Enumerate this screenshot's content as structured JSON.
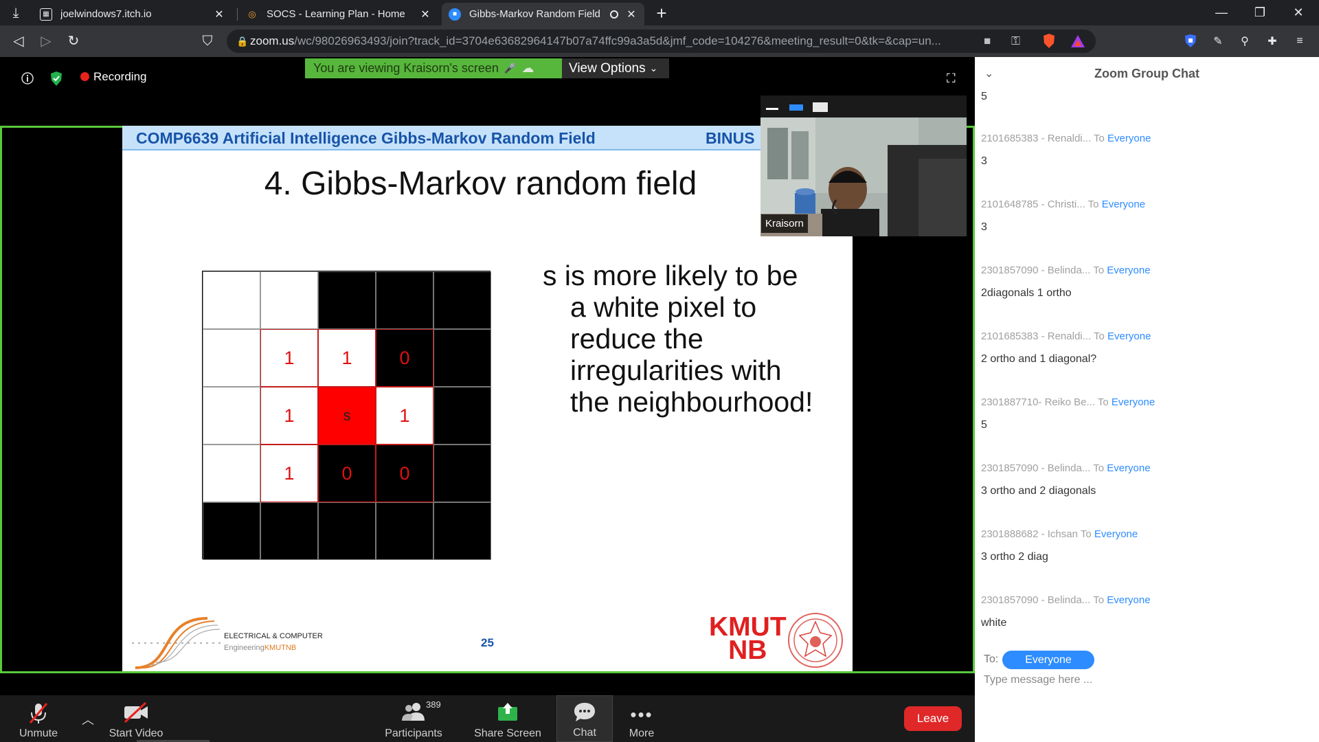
{
  "browser": {
    "tabs": [
      {
        "title": "joelwindows7.itch.io",
        "icon": "itch-icon"
      },
      {
        "title": "SOCS - Learning Plan - Home",
        "icon": "socs-icon"
      },
      {
        "title": "Gibbs-Markov Random Field",
        "icon": "zoom-icon"
      }
    ],
    "url_host": "zoom.us",
    "url_path": "/wc/98026963493/join?track_id=3704e63682964147b07a74ffc99a3a5d&jmf_code=104276&meeting_result=0&tk=&cap=un..."
  },
  "meeting": {
    "recording_label": "Recording",
    "viewing_banner": "You are viewing Kraisorn's screen",
    "view_options_label": "View Options",
    "video_name": "Kraisorn"
  },
  "slide": {
    "course_header": "COMP6639 Artificial Intelligence Gibbs-Markov Random Field",
    "header_right": "BINUS",
    "title": "4. Gibbs-Markov random field",
    "grid": [
      [
        {
          "c": "w",
          "t": ""
        },
        {
          "c": "w",
          "t": ""
        },
        {
          "c": "b",
          "t": ""
        },
        {
          "c": "b",
          "t": ""
        },
        {
          "c": "b",
          "t": ""
        }
      ],
      [
        {
          "c": "w",
          "t": ""
        },
        {
          "c": "w",
          "t": "1",
          "o": true
        },
        {
          "c": "w",
          "t": "1",
          "o": true
        },
        {
          "c": "b",
          "t": "0",
          "o": true
        },
        {
          "c": "b",
          "t": ""
        }
      ],
      [
        {
          "c": "w",
          "t": ""
        },
        {
          "c": "w",
          "t": "1",
          "o": true
        },
        {
          "c": "r",
          "t": "s",
          "o": true
        },
        {
          "c": "w",
          "t": "1",
          "o": true
        },
        {
          "c": "b",
          "t": ""
        }
      ],
      [
        {
          "c": "w",
          "t": ""
        },
        {
          "c": "w",
          "t": "1",
          "o": true
        },
        {
          "c": "b",
          "t": "0",
          "o": true
        },
        {
          "c": "b",
          "t": "0",
          "o": true
        },
        {
          "c": "b",
          "t": ""
        }
      ],
      [
        {
          "c": "b",
          "t": ""
        },
        {
          "c": "b",
          "t": ""
        },
        {
          "c": "b",
          "t": ""
        },
        {
          "c": "b",
          "t": ""
        },
        {
          "c": "b",
          "t": ""
        }
      ]
    ],
    "text_lines": [
      "s is more likely to be",
      "a white pixel to",
      "reduce the",
      "irregularities with",
      "the neighbourhood!"
    ],
    "ece_line1": "ELECTRICAL & COMPUTER",
    "ece_line2a": "Engineering",
    "ece_line2b": "KMUTNB",
    "page_number": "25",
    "kmutnb_line1": "KMUT",
    "kmutnb_line2": "NB"
  },
  "toolbar": {
    "unmute": "Unmute",
    "start_video": "Start Video",
    "participants": "Participants",
    "participants_count": "389",
    "share_screen": "Share Screen",
    "chat": "Chat",
    "more": "More",
    "leave": "Leave"
  },
  "chat": {
    "title": "Zoom Group Chat",
    "first_message": "5",
    "to_word": "To",
    "messages": [
      {
        "sender": "2101685383 - Renaldi...",
        "recipient": "Everyone",
        "text": "3"
      },
      {
        "sender": "2101648785 - Christi...",
        "recipient": "Everyone",
        "text": "3"
      },
      {
        "sender": "2301857090 - Belinda...",
        "recipient": "Everyone",
        "text": "2diagonals 1 ortho"
      },
      {
        "sender": "2101685383 - Renaldi...",
        "recipient": "Everyone",
        "text": "2 ortho and 1 diagonal?"
      },
      {
        "sender": "2301887710- Reiko Be...",
        "recipient": "Everyone",
        "text": "5"
      },
      {
        "sender": "2301857090 - Belinda...",
        "recipient": "Everyone",
        "text": "3 ortho and 2 diagonals"
      },
      {
        "sender": "2301888682 - Ichsan",
        "recipient": "Everyone",
        "text": "3 ortho 2 diag"
      },
      {
        "sender": "2301857090 - Belinda...",
        "recipient": "Everyone",
        "text": "white"
      }
    ],
    "to_label": "To:",
    "to_target": "Everyone",
    "input_placeholder": "Type message here ..."
  },
  "colors": {
    "zoom_green": "#57b73c",
    "zoom_blue": "#2d8cff",
    "leave_red": "#e02828",
    "slide_blue": "#1754a8"
  }
}
